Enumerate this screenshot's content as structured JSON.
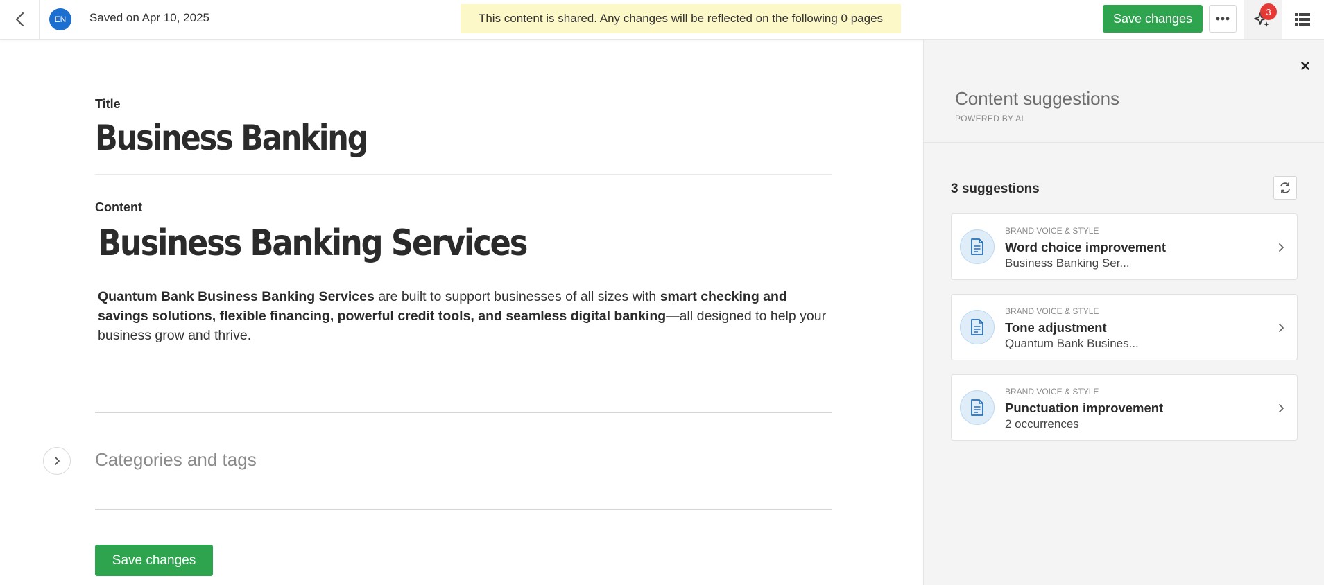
{
  "topbar": {
    "lang": "EN",
    "saved": "Saved on Apr 10, 2025",
    "shared_banner": "This content is shared. Any changes will be reflected on the following 0 pages",
    "save_label": "Save changes",
    "ai_badge_count": "3"
  },
  "editor": {
    "title_label": "Title",
    "title_value": "Business Banking",
    "content_label": "Content",
    "content_heading": "Business Banking Services",
    "para": {
      "b1": "Quantum Bank Business Banking Services",
      "t1": " are built to support businesses of all sizes with ",
      "b2": "smart checking and savings solutions, flexible financing, powerful credit tools, and seamless digital banking",
      "t2": "—all designed to help your business grow and thrive."
    },
    "categories_label": "Categories and tags",
    "save_label": "Save changes"
  },
  "panel": {
    "title": "Content suggestions",
    "subtitle": "POWERED BY AI",
    "count_label": "3 suggestions",
    "suggestions": [
      {
        "category": "BRAND VOICE & STYLE",
        "name": "Word choice improvement",
        "detail": "Business Banking Ser..."
      },
      {
        "category": "BRAND VOICE & STYLE",
        "name": "Tone adjustment",
        "detail": "Quantum Bank Busines..."
      },
      {
        "category": "BRAND VOICE & STYLE",
        "name": "Punctuation improvement",
        "detail": "2 occurrences"
      }
    ]
  },
  "colors": {
    "accent_green": "#2ea44f",
    "lang_blue": "#1a6fd1",
    "banner_yellow": "#fdf8c8",
    "badge_red": "#e53935"
  }
}
